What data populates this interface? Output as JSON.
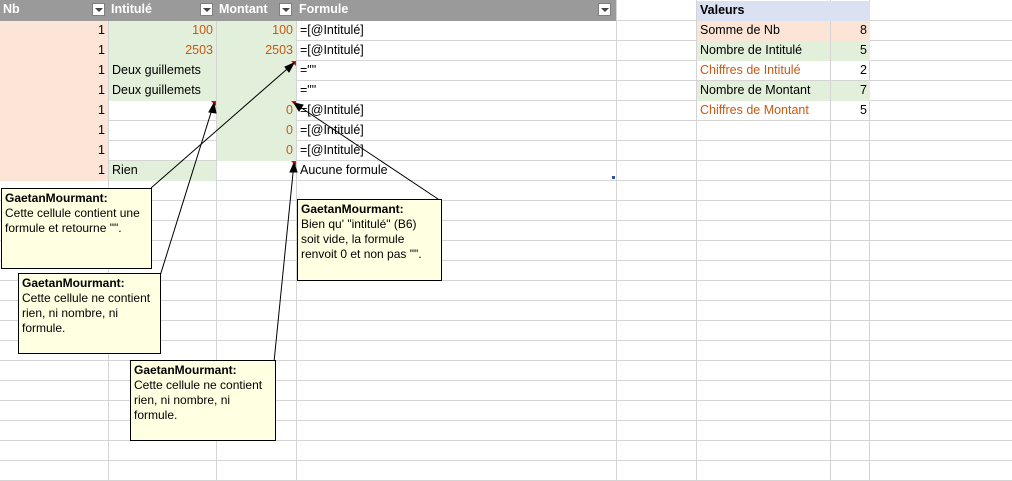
{
  "table": {
    "headers": [
      "Nb",
      "Intitulé",
      "Montant",
      "Formule"
    ],
    "rows": [
      {
        "nb": "1",
        "intitule": "100",
        "montant": "100",
        "formule": "=[@Intitulé]"
      },
      {
        "nb": "1",
        "intitule": "2503",
        "montant": "2503",
        "formule": "=[@Intitulé]"
      },
      {
        "nb": "1",
        "intitule": "Deux guillemets",
        "montant": "",
        "formule": "=\"\""
      },
      {
        "nb": "1",
        "intitule": "Deux guillemets",
        "montant": "",
        "formule": "=\"\""
      },
      {
        "nb": "1",
        "intitule": "",
        "montant": "0",
        "formule": "=[@Intitulé]"
      },
      {
        "nb": "1",
        "intitule": "",
        "montant": "0",
        "formule": "=[@Intitulé]"
      },
      {
        "nb": "1",
        "intitule": "",
        "montant": "0",
        "formule": "=[@Intitulé]"
      },
      {
        "nb": "1",
        "intitule": "Rien",
        "montant": "",
        "formule": "Aucune formule"
      }
    ]
  },
  "summary": {
    "header": "Valeurs",
    "rows": [
      {
        "label": "Somme de Nb",
        "value": "8"
      },
      {
        "label": "Nombre de Intitulé",
        "value": "5"
      },
      {
        "label": "Chiffres de Intitulé",
        "value": "2"
      },
      {
        "label": "Nombre de Montant",
        "value": "7"
      },
      {
        "label": "Chiffres de Montant",
        "value": "5"
      }
    ]
  },
  "comments": [
    {
      "author": "GaetanMourmant:",
      "text": "Cette cellule contient une formule et retourne \"\"."
    },
    {
      "author": "GaetanMourmant:",
      "text": "Cette cellule ne contient rien, ni nombre, ni formule."
    },
    {
      "author": "GaetanMourmant:",
      "text": "Cette cellule ne contient rien, ni nombre, ni formule."
    },
    {
      "author": "GaetanMourmant:",
      "text": "Bien qu' \"intitulé\" (B6) soit vide, la formule renvoit 0 et non pas \"\"."
    }
  ],
  "colors": {
    "header_gray": "#9a9a9a",
    "salmon_fill": "#fce4d6",
    "green_fill": "#e2efda",
    "orange_text": "#c65911",
    "summary_header_fill": "#d9e1f2",
    "note_fill": "#ffffe1",
    "comment_indicator": "#ff0000"
  },
  "icons": {
    "filter": "filter-dropdown-icon",
    "comment": "comment-indicator-icon"
  }
}
